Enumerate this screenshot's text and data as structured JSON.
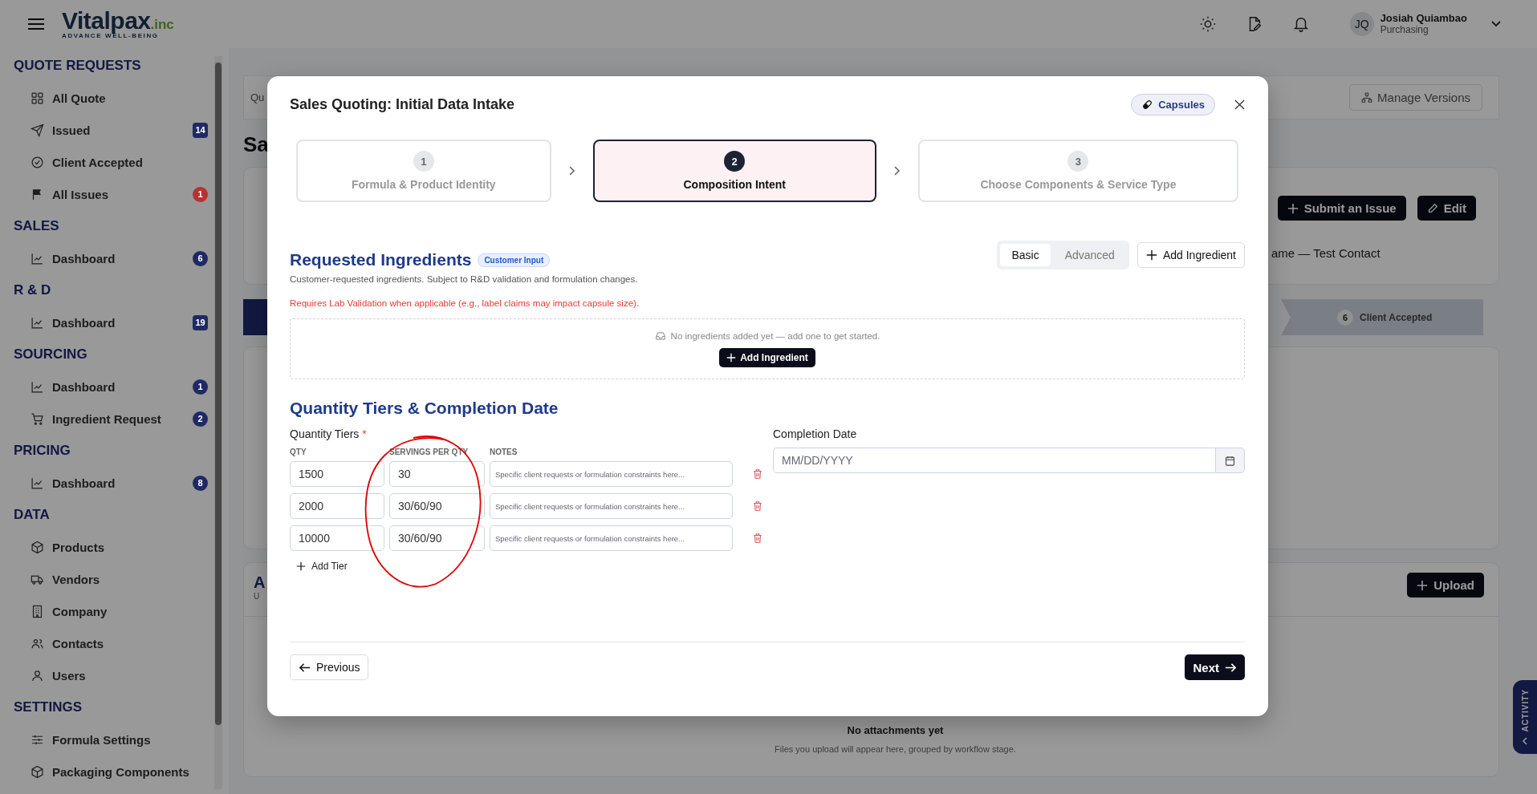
{
  "topbar": {
    "logo": {
      "name": "Vitalpax",
      "suffix": ".inc",
      "tagline": "ADVANCE WELL-BEING"
    },
    "user": {
      "initials": "JQ",
      "name": "Josiah Quiambao",
      "role": "Purchasing"
    }
  },
  "sidebar": [
    {
      "title": "QUOTE REQUESTS",
      "items": [
        {
          "label": "All Quote"
        },
        {
          "label": "Issued",
          "badge": "14",
          "color": "#1f2a63"
        },
        {
          "label": "Client Accepted"
        },
        {
          "label": "All Issues",
          "badge": "1",
          "color": "#b83232"
        }
      ]
    },
    {
      "title": "SALES",
      "items": [
        {
          "label": "Dashboard",
          "badge": "6",
          "color": "#1f2a63"
        }
      ]
    },
    {
      "title": "R & D",
      "items": [
        {
          "label": "Dashboard",
          "badge": "19",
          "color": "#1f2a63"
        }
      ]
    },
    {
      "title": "SOURCING",
      "items": [
        {
          "label": "Dashboard",
          "badge": "1",
          "color": "#1f2a63"
        },
        {
          "label": "Ingredient Request",
          "badge": "2",
          "color": "#1f2a63"
        }
      ]
    },
    {
      "title": "PRICING",
      "items": [
        {
          "label": "Dashboard",
          "badge": "8",
          "color": "#1f2a63"
        }
      ]
    },
    {
      "title": "DATA",
      "items": [
        {
          "label": "Products"
        },
        {
          "label": "Vendors"
        },
        {
          "label": "Company"
        },
        {
          "label": "Contacts"
        },
        {
          "label": "Users"
        }
      ]
    },
    {
      "title": "SETTINGS",
      "items": [
        {
          "label": "Formula Settings"
        },
        {
          "label": "Packaging Components"
        }
      ]
    }
  ],
  "page": {
    "tab": "Qu",
    "manage_versions": "Manage Versions",
    "title": "Sa",
    "actions": [
      "Submit an Issue",
      "Edit"
    ],
    "contact": "ame — Test Contact",
    "stage": {
      "number": "6",
      "label": "Client Accepted"
    },
    "attachments": {
      "title": "A",
      "subtitle": "U",
      "upload": "Upload",
      "empty_title": "No attachments yet",
      "empty_text": "Files you upload will appear here, grouped by workflow stage."
    },
    "activity": "ACTIVITY"
  },
  "modal": {
    "title": "Sales Quoting: Initial Data Intake",
    "product_tag": "Capsules",
    "steps": [
      {
        "number": "1",
        "label": "Formula & Product Identity",
        "selected": false
      },
      {
        "number": "2",
        "label": "Composition Intent",
        "selected": true
      },
      {
        "number": "3",
        "label": "Choose Components & Service Type",
        "selected": false
      }
    ],
    "ingredients": {
      "title": "Requested Ingredients",
      "badge": "Customer Input",
      "description": "Customer-requested ingredients. Subject to R&D validation and formulation changes.",
      "warning": "Requires Lab Validation when applicable (e.g., label claims may impact capsule size).",
      "view_toggle": [
        {
          "label": "Basic",
          "selected": true
        },
        {
          "label": "Advanced",
          "selected": false
        }
      ],
      "add_button": "Add Ingredient",
      "empty_text": "No ingredients added yet — add one to get started.",
      "empty_button": "Add Ingredient"
    },
    "tiers": {
      "title": "Quantity Tiers & Completion Date",
      "label": "Quantity Tiers",
      "required_mark": "*",
      "columns": [
        "QTY",
        "SERVINGS PER QTY",
        "NOTES"
      ],
      "rows": [
        {
          "qty": "1500",
          "servings": "30",
          "notes_placeholder": "Specific client requests or formulation constraints here..."
        },
        {
          "qty": "2000",
          "servings": "30/60/90",
          "notes_placeholder": "Specific client requests or formulation constraints here..."
        },
        {
          "qty": "10000",
          "servings": "30/60/90",
          "notes_placeholder": "Specific client requests or formulation constraints here..."
        }
      ],
      "add_button": "Add Tier",
      "completion": {
        "label": "Completion Date",
        "placeholder": "MM/DD/YYYY"
      }
    },
    "footer": {
      "previous": "Previous",
      "next": "Next"
    }
  }
}
